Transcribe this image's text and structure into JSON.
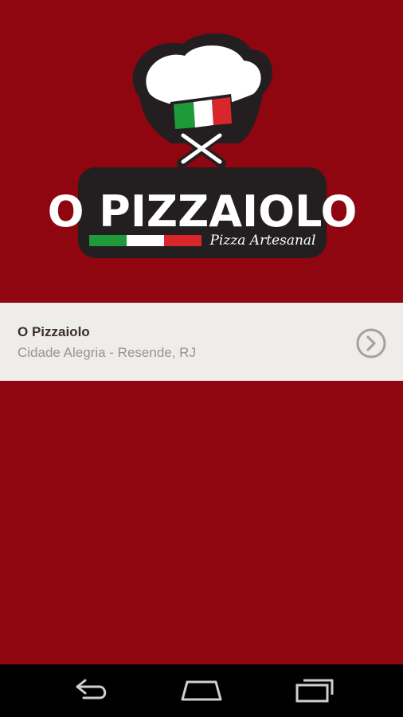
{
  "brand": {
    "logo_text": "O PIZZAIOLO",
    "tagline": "Pizza Artesanal"
  },
  "stores": [
    {
      "name": "O Pizzaiolo",
      "address": "Cidade Alegria - Resende, RJ"
    }
  ],
  "colors": {
    "background": "#8f0610",
    "list_background": "#efedea",
    "flag_green": "#1f9a3a",
    "flag_white": "#ffffff",
    "flag_red": "#d9262a"
  },
  "icons": {
    "store_action": "chevron-right-circle-icon",
    "nav_back": "back-icon",
    "nav_home": "home-icon",
    "nav_recents": "recents-icon"
  }
}
